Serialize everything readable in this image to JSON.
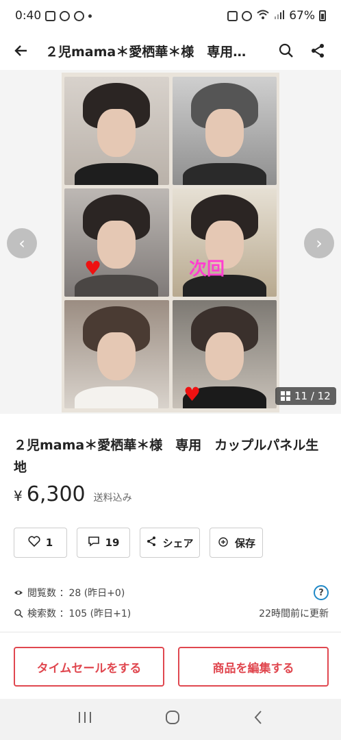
{
  "status_bar": {
    "time": "0:40",
    "battery": "67%"
  },
  "header": {
    "title": "２児mama＊愛栖華＊様　専用…"
  },
  "gallery": {
    "counter": "11 / 12",
    "overlay_text": "次回"
  },
  "product": {
    "title": "２児mama＊愛栖華＊様　専用　カップルパネル生地",
    "currency": "¥",
    "price": "6,300",
    "shipping": "送料込み"
  },
  "actions": {
    "like_count": "1",
    "comment_count": "19",
    "share_label": "シェア",
    "save_label": "保存"
  },
  "stats": {
    "views": "閲覧数 ：28 (昨日+0)",
    "searches": "検索数 ：105 (昨日+1)",
    "updated": "22時間前に更新",
    "help": "?"
  },
  "bottom": {
    "time_sale_label": "タイムセールをする",
    "edit_label": "商品を編集する"
  },
  "colors": {
    "accent": "#e0474f",
    "help": "#1e88c7",
    "overlay_text": "#ff3fd0"
  },
  "icons": [
    "back-arrow-icon",
    "search-icon",
    "share-icon",
    "heart-icon",
    "comment-icon",
    "save-icon",
    "eye-icon",
    "search-small-icon",
    "grid-icon"
  ]
}
